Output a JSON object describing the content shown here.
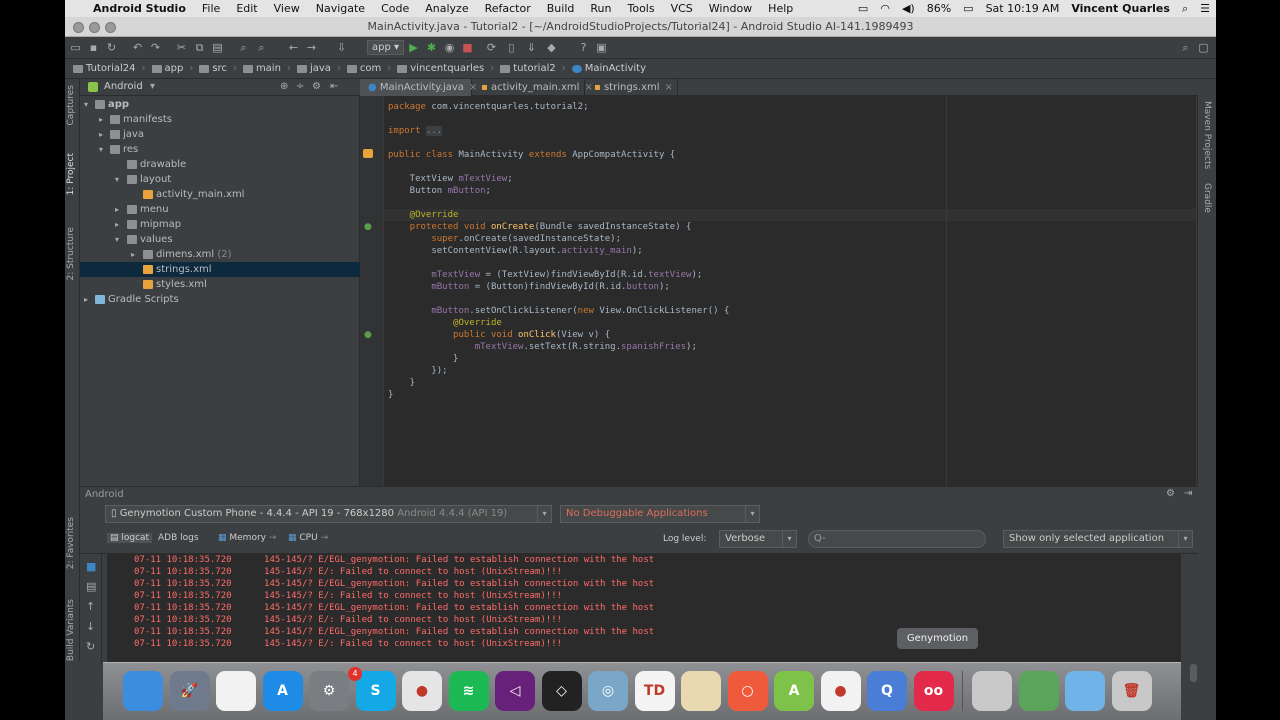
{
  "menubar": {
    "app_name": "Android Studio",
    "items": [
      "File",
      "Edit",
      "View",
      "Navigate",
      "Code",
      "Analyze",
      "Refactor",
      "Build",
      "Run",
      "Tools",
      "VCS",
      "Window",
      "Help"
    ],
    "battery": "86%",
    "clock": "Sat 10:19 AM",
    "user": "Vincent Quarles"
  },
  "window": {
    "title": "MainActivity.java - Tutorial2 - [~/AndroidStudioProjects/Tutorial24] - Android Studio AI-141.1989493"
  },
  "toolbar": {
    "run_config": "app"
  },
  "breadcrumbs": [
    "Tutorial24",
    "app",
    "src",
    "main",
    "java",
    "com",
    "vincentquarles",
    "tutorial2",
    "MainActivity"
  ],
  "project_panel": {
    "view_mode": "Android",
    "tree": [
      {
        "label": "app",
        "depth": 0,
        "arrow": "▾",
        "bold": true
      },
      {
        "label": "manifests",
        "depth": 1,
        "arrow": "▸"
      },
      {
        "label": "java",
        "depth": 1,
        "arrow": "▸"
      },
      {
        "label": "res",
        "depth": 1,
        "arrow": "▾"
      },
      {
        "label": "drawable",
        "depth": 2,
        "arrow": ""
      },
      {
        "label": "layout",
        "depth": 2,
        "arrow": "▾"
      },
      {
        "label": "activity_main.xml",
        "depth": 3,
        "arrow": "",
        "file": true
      },
      {
        "label": "menu",
        "depth": 2,
        "arrow": "▸"
      },
      {
        "label": "mipmap",
        "depth": 2,
        "arrow": "▸"
      },
      {
        "label": "values",
        "depth": 2,
        "arrow": "▾"
      },
      {
        "label": "dimens.xml",
        "suffix": "(2)",
        "depth": 3,
        "arrow": "▸",
        "file": true
      },
      {
        "label": "strings.xml",
        "depth": 3,
        "arrow": "",
        "file": true,
        "selected": true
      },
      {
        "label": "styles.xml",
        "depth": 3,
        "arrow": "",
        "file": true
      },
      {
        "label": "Gradle Scripts",
        "depth": 0,
        "arrow": "▸"
      }
    ]
  },
  "left_strip_tabs": [
    "Captures",
    "1: Project",
    "2: Structure",
    "2: Favorites",
    "Build Variants"
  ],
  "right_strip_tabs": [
    "Maven Projects",
    "Gradle"
  ],
  "editor": {
    "tabs": [
      {
        "label": "MainActivity.java",
        "active": true
      },
      {
        "label": "activity_main.xml",
        "active": false
      },
      {
        "label": "strings.xml",
        "active": false
      }
    ],
    "code_lines": [
      [
        [
          "kw",
          "package "
        ],
        [
          "",
          "com.vincentquarles.tutorial2;"
        ]
      ],
      [],
      [
        [
          "kw",
          "import "
        ],
        [
          "fold",
          "..."
        ]
      ],
      [],
      [
        [
          "kw",
          "public class "
        ],
        [
          "",
          "MainActivity "
        ],
        [
          "kw",
          "extends "
        ],
        [
          "",
          "AppCompatActivity {"
        ]
      ],
      [],
      [
        [
          "",
          "    TextView "
        ],
        [
          "fld",
          "mTextView"
        ],
        [
          "",
          ";"
        ]
      ],
      [
        [
          "",
          "    Button "
        ],
        [
          "fld",
          "mButton"
        ],
        [
          "",
          ";"
        ]
      ],
      [],
      [
        [
          "ann",
          "    @Override"
        ]
      ],
      [
        [
          "kw",
          "    protected void "
        ],
        [
          "fn",
          "onCreate"
        ],
        [
          "",
          "(Bundle savedInstanceState) {"
        ]
      ],
      [
        [
          "kw",
          "        super"
        ],
        [
          "",
          ".onCreate(savedInstanceState);"
        ]
      ],
      [
        [
          "",
          "        setContentView(R.layout."
        ],
        [
          "fld",
          "activity_main"
        ],
        [
          "",
          ");"
        ]
      ],
      [],
      [
        [
          "fld",
          "        mTextView "
        ],
        [
          "",
          "= (TextView)findViewById(R.id."
        ],
        [
          "fld",
          "textView"
        ],
        [
          "",
          ");"
        ]
      ],
      [
        [
          "fld",
          "        mButton "
        ],
        [
          "",
          "= (Button)findViewById(R.id."
        ],
        [
          "fld",
          "button"
        ],
        [
          "",
          ");"
        ]
      ],
      [],
      [
        [
          "fld",
          "        mButton"
        ],
        [
          "",
          ".setOnClickListener("
        ],
        [
          "kw",
          "new "
        ],
        [
          "",
          "View.OnClickListener() {"
        ]
      ],
      [
        [
          "ann",
          "            @Override"
        ]
      ],
      [
        [
          "kw",
          "            public void "
        ],
        [
          "fn",
          "onClick"
        ],
        [
          "",
          "(View v) {"
        ]
      ],
      [
        [
          "fld",
          "                mTextView"
        ],
        [
          "",
          ".setText(R.string."
        ],
        [
          "fld",
          "spanishFries"
        ],
        [
          "",
          ");"
        ]
      ],
      [
        [
          "",
          "            }"
        ]
      ],
      [
        [
          "",
          "        });"
        ]
      ],
      [
        [
          "",
          "    }"
        ]
      ],
      [
        [
          "",
          "}"
        ]
      ]
    ]
  },
  "android_panel": {
    "title": "Android",
    "device": "Genymotion Custom Phone - 4.4.4 - API 19 - 768x1280",
    "device_suffix": "Android 4.4.4 (API 19)",
    "app_status": "No Debuggable Applications",
    "tabs": [
      "logcat",
      "ADB logs",
      "Memory",
      "CPU"
    ],
    "log_level_label": "Log level:",
    "log_level": "Verbose",
    "search_placeholder": "Q-",
    "filter": "Show only selected application",
    "log_lines": [
      "07-11 10:18:35.720      145-145/? E/EGL_genymotion: Failed to establish connection with the host",
      "07-11 10:18:35.720      145-145/? E/: Failed to connect to host (UnixStream)!!!",
      "07-11 10:18:35.720      145-145/? E/EGL_genymotion: Failed to establish connection with the host",
      "07-11 10:18:35.720      145-145/? E/: Failed to connect to host (UnixStream)!!!",
      "07-11 10:18:35.720      145-145/? E/EGL_genymotion: Failed to establish connection with the host",
      "07-11 10:18:35.720      145-145/? E/: Failed to connect to host (UnixStream)!!!",
      "07-11 10:18:35.720      145-145/? E/EGL_genymotion: Failed to establish connection with the host",
      "07-11 10:18:35.720      145-145/? E/: Failed to connect to host (UnixStream)!!!"
    ]
  },
  "dock": {
    "tooltip": "Genymotion",
    "badge": "4",
    "apps": [
      {
        "name": "finder-icon",
        "color": "#3b8de0",
        "glyph": ""
      },
      {
        "name": "launchpad-icon",
        "color": "#6f7b8c",
        "glyph": "🚀"
      },
      {
        "name": "textedit-icon",
        "color": "#f2f2f2",
        "glyph": ""
      },
      {
        "name": "app-store-icon",
        "color": "#1e8ce6",
        "glyph": "A"
      },
      {
        "name": "system-preferences-icon",
        "color": "#7a7d82",
        "glyph": "⚙"
      },
      {
        "name": "skype-icon",
        "color": "#14a8e6",
        "glyph": "S"
      },
      {
        "name": "chrome-icon",
        "color": "#e5e5e5",
        "glyph": "●"
      },
      {
        "name": "spotify-icon",
        "color": "#1db954",
        "glyph": "≋"
      },
      {
        "name": "visual-studio-icon",
        "color": "#68217a",
        "glyph": "◁"
      },
      {
        "name": "unity-icon",
        "color": "#222222",
        "glyph": "◇"
      },
      {
        "name": "network-icon",
        "color": "#7aa6c8",
        "glyph": "◎"
      },
      {
        "name": "td-icon",
        "color": "#f4f4f4",
        "glyph": "TD"
      },
      {
        "name": "preview-icon",
        "color": "#e8d9b0",
        "glyph": ""
      },
      {
        "name": "clipper-icon",
        "color": "#f05a3c",
        "glyph": "○"
      },
      {
        "name": "android-studio-icon",
        "color": "#7ec24a",
        "glyph": "A"
      },
      {
        "name": "recorder-icon",
        "color": "#f2f2f2",
        "glyph": "●"
      },
      {
        "name": "quicktime-icon",
        "color": "#4a7ed6",
        "glyph": "Q"
      },
      {
        "name": "genymotion-icon",
        "color": "#e32a4a",
        "glyph": "oo"
      },
      {
        "name": "documents-icon",
        "color": "#c9c9c9",
        "glyph": ""
      },
      {
        "name": "photos-icon",
        "color": "#5aa55a",
        "glyph": ""
      },
      {
        "name": "folder-icon",
        "color": "#6fb3e8",
        "glyph": ""
      },
      {
        "name": "trash-icon",
        "color": "#c8c8c8",
        "glyph": "🗑"
      }
    ]
  }
}
